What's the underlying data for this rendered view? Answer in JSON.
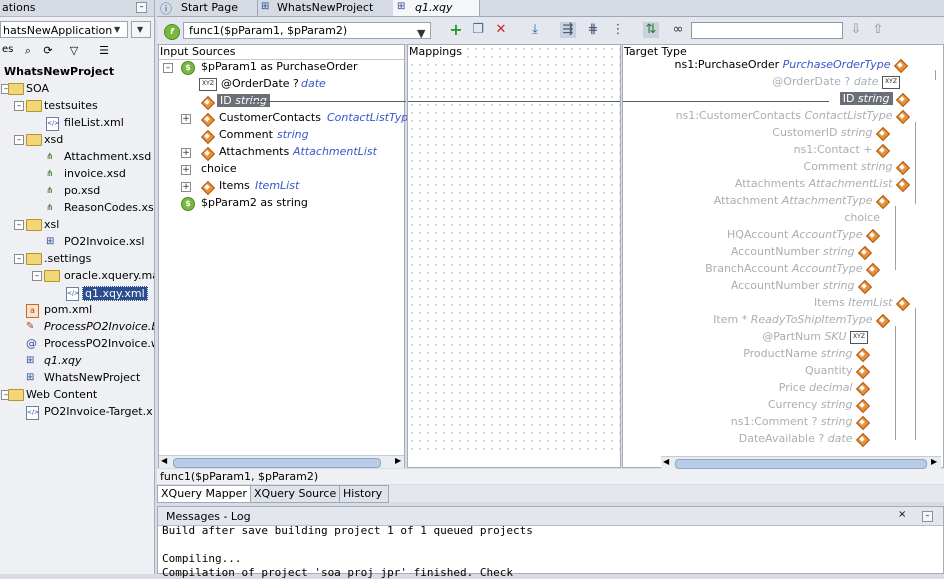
{
  "left_panel": {
    "title": "ations",
    "app_selector": "hatsNewApplication",
    "tree": [
      {
        "label": "WhatsNewProject",
        "bold": true
      },
      {
        "label": "SOA"
      },
      {
        "label": "testsuites"
      },
      {
        "label": "fileList.xml"
      },
      {
        "label": "xsd"
      },
      {
        "label": "Attachment.xsd"
      },
      {
        "label": "invoice.xsd"
      },
      {
        "label": "po.xsd"
      },
      {
        "label": "ReasonCodes.xs"
      },
      {
        "label": "xsl"
      },
      {
        "label": "PO2Invoice.xsl"
      },
      {
        "label": ".settings"
      },
      {
        "label": "oracle.xquery.ma"
      },
      {
        "label": "q1.xqy.xml"
      },
      {
        "label": "pom.xml"
      },
      {
        "label": "ProcessPO2Invoice.b"
      },
      {
        "label": "ProcessPO2Invoice.w"
      },
      {
        "label": "q1.xqy"
      },
      {
        "label": "WhatsNewProject"
      },
      {
        "label": "Web Content"
      },
      {
        "label": "PO2Invoice-Target.x"
      }
    ]
  },
  "tabs": [
    {
      "label": "Start Page"
    },
    {
      "label": "WhatsNewProject"
    },
    {
      "label": "q1.xqy"
    }
  ],
  "toolbar": {
    "function_select": "func1($pParam1, $pParam2)",
    "search_placeholder": ""
  },
  "source": {
    "header": "Input Sources",
    "nodes": [
      {
        "name": "$pParam1 as PurchaseOrder",
        "type": ""
      },
      {
        "name": "@OrderDate ?",
        "type": "date"
      },
      {
        "name": "ID",
        "type": "string"
      },
      {
        "name": "CustomerContacts",
        "type": "ContactListTyp"
      },
      {
        "name": "Comment",
        "type": "string"
      },
      {
        "name": "Attachments",
        "type": "AttachmentList"
      },
      {
        "name": "choice",
        "type": ""
      },
      {
        "name": "Items",
        "type": "ItemList"
      },
      {
        "name": "$pParam2 as string",
        "type": ""
      }
    ]
  },
  "mappings": {
    "header": "Mappings"
  },
  "target": {
    "header": "Target Type",
    "nodes": [
      {
        "name": "ns1:PurchaseOrder",
        "type": "PurchaseOrderType"
      },
      {
        "name": "@OrderDate ?",
        "type": "date"
      },
      {
        "name": "ID",
        "type": "string"
      },
      {
        "name": "ns1:CustomerContacts",
        "type": "ContactListType"
      },
      {
        "name": "CustomerID",
        "type": "string"
      },
      {
        "name": "ns1:Contact +",
        "type": ""
      },
      {
        "name": "Comment",
        "type": "string"
      },
      {
        "name": "Attachments",
        "type": "AttachmentList"
      },
      {
        "name": "Attachment",
        "type": "AttachmentType"
      },
      {
        "name": "choice",
        "type": ""
      },
      {
        "name": "HQAccount",
        "type": "AccountType"
      },
      {
        "name": "AccountNumber",
        "type": "string"
      },
      {
        "name": "BranchAccount",
        "type": "AccountType"
      },
      {
        "name": "AccountNumber",
        "type": "string"
      },
      {
        "name": "Items",
        "type": "ItemList"
      },
      {
        "name": "Item *",
        "type": "ReadyToShipItemType"
      },
      {
        "name": "@PartNum",
        "type": "SKU"
      },
      {
        "name": "ProductName",
        "type": "string"
      },
      {
        "name": "Quantity",
        "type": ""
      },
      {
        "name": "Price",
        "type": "decimal"
      },
      {
        "name": "Currency",
        "type": "string"
      },
      {
        "name": "ns1:Comment ?",
        "type": "string"
      },
      {
        "name": "DateAvailable ?",
        "type": "date"
      }
    ]
  },
  "status_text": "func1($pParam1, $pParam2)",
  "bottom_tabs": [
    {
      "label": "XQuery Mapper"
    },
    {
      "label": "XQuery Source"
    },
    {
      "label": "History"
    }
  ],
  "messages": {
    "title": "Messages - Log",
    "lines": [
      "Build after save building project 1 of 1 queued projects",
      "",
      "Compiling...",
      "Compilation of project 'soa proj jpr' finished. Check"
    ]
  },
  "icons": {
    "help": "help-icon",
    "function": "function-icon",
    "add": "add-icon",
    "delete": "delete-icon",
    "binoculars": "binoculars-icon"
  },
  "colors": {
    "accent": "#3a55c8",
    "selection": "#6b6f78",
    "highlight_node": "#e8913a"
  }
}
